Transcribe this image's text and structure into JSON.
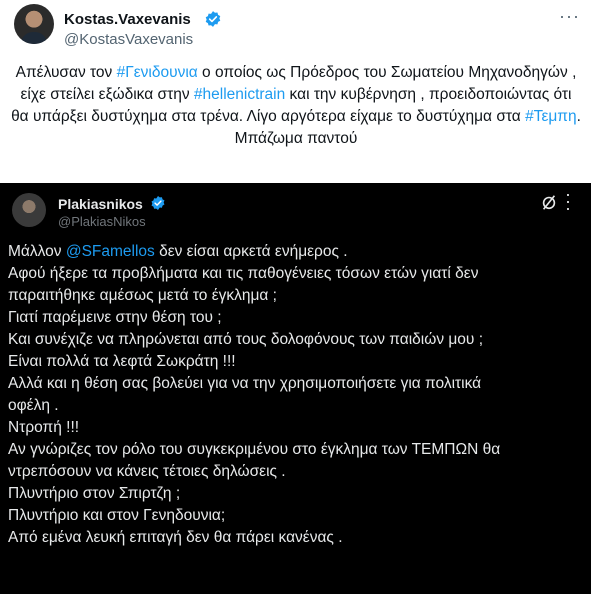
{
  "tweet": {
    "author_name": "Kostas.Vaxevanis",
    "author_handle": "@KostasVaxevanis",
    "text_parts": {
      "p1": "Απέλυσαν τον ",
      "tag1": "#Γενιδουνια",
      "p2": " ο οποίος ως Πρόεδρος του Σωματείου Μηχανοδηγών , είχε στείλει εξώδικα στην ",
      "tag2": "#hellenictrain",
      "p3": " και την κυβέρνηση , προειδοποιώντας ότι θα υπάρξει δυστύχημα στα τρένα. Λίγο αργότερα είχαμε το δυστύχημα στα ",
      "tag3": "#Τεμπη",
      "p4": ". Μπάζωμα παντού"
    }
  },
  "quoted_screenshot": {
    "author_name": "Plakiasnikos",
    "author_handle": "@PlakiasNikos",
    "first_line_prefix": "Μάλλον ",
    "mention": "@SFamellos",
    "first_line_suffix": " δεν είσαι αρκετά ενήμερος .",
    "lines": [
      "Αφού ήξερε τα προβλήματα και τις παθογένειες τόσων ετών γιατί δεν",
      "παραιτήθηκε αμέσως μετά το έγκλημα ;",
      "Γιατί παρέμεινε στην θέση του ;",
      "Και συνέχιζε να πληρώνεται από τους δολοφόνους των παιδιών μου ;",
      "Είναι πολλά τα λεφτά Σωκράτη !!!",
      "Αλλά και η θέση σας βολεύει για να την χρησιμοποιήσετε για πολιτικά",
      "οφέλη .",
      "Ντροπή !!!",
      "Αν γνώριζες τον ρόλο του συγκεκριμένου στο έγκλημα των ΤΕΜΠΩΝ θα",
      "ντρεπόσουν να κάνεις τέτοιες δηλώσεις .",
      "Πλυντήριο στον Σπιρτζη ;",
      "Πλυντήριο και στον Γενηδουνια;",
      "Από εμένα λευκή επιταγή δεν θα πάρει κανένας ."
    ]
  },
  "colors": {
    "accent": "#1d9bf0",
    "text": "#0f1419",
    "muted": "#536471",
    "dark_bg": "#000000",
    "dark_text": "#e7e9ea"
  },
  "icons": [
    "verified-badge-icon",
    "more-options-icon",
    "edit-slash-icon"
  ]
}
